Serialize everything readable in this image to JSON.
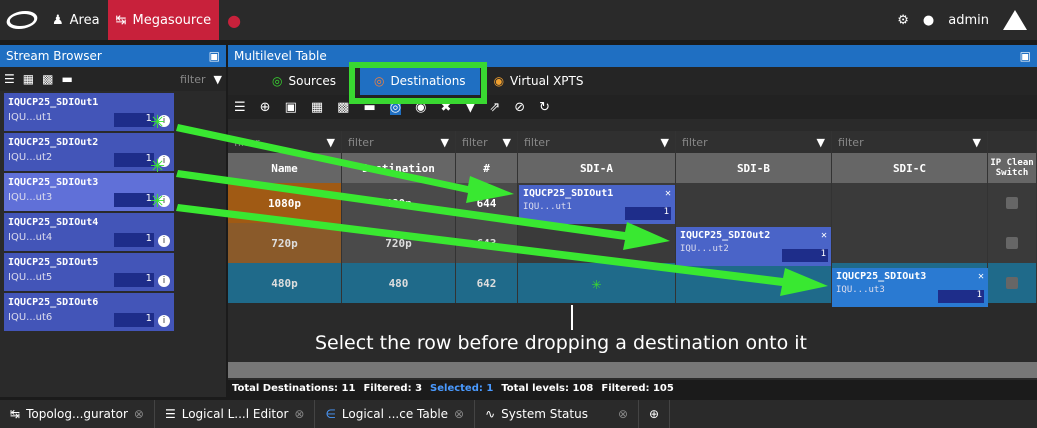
{
  "topbar": {
    "area": "Area",
    "megasource": "Megasource",
    "user": "admin"
  },
  "left": {
    "title": "Stream Browser",
    "filter": "filter",
    "items": [
      {
        "name": "IQUCP25_SDIOut1",
        "sub": "IQU...ut1",
        "count": "1"
      },
      {
        "name": "IQUCP25_SDIOut2",
        "sub": "IQU...ut2",
        "count": "1"
      },
      {
        "name": "IQUCP25_SDIOut3",
        "sub": "IQU...ut3",
        "count": "1"
      },
      {
        "name": "IQUCP25_SDIOut4",
        "sub": "IQU...ut4",
        "count": "1"
      },
      {
        "name": "IQUCP25_SDIOut5",
        "sub": "IQU...ut5",
        "count": "1"
      },
      {
        "name": "IQUCP25_SDIOut6",
        "sub": "IQU...ut6",
        "count": "1"
      }
    ]
  },
  "right": {
    "title": "Multilevel Table",
    "tabs": [
      "Sources",
      "Destinations",
      "Virtual XPTS"
    ],
    "filters": [
      "filter",
      "filter",
      "filter",
      "filter",
      "filter",
      "filter"
    ],
    "headers": [
      "Name",
      "Destination",
      "#",
      "SDI-A",
      "SDI-B",
      "SDI-C",
      "IP Clean Switch"
    ],
    "rows": [
      {
        "name": "1080p",
        "dest": "480p",
        "num": "644"
      },
      {
        "name": "720p",
        "dest": "720p",
        "num": "643"
      },
      {
        "name": "480p",
        "dest": "480",
        "num": "642"
      }
    ],
    "drops": [
      {
        "name": "IQUCP25_SDIOut1",
        "sub": "IQU...ut1",
        "count": "1"
      },
      {
        "name": "IQUCP25_SDIOut2",
        "sub": "IQU...ut2",
        "count": "1"
      },
      {
        "name": "IQUCP25_SDIOut3",
        "sub": "IQU...ut3",
        "count": "1"
      }
    ],
    "status": {
      "total": "Total Destinations: 11",
      "filtered": "Filtered: 3",
      "selected": "Selected: 1",
      "levels": "Total levels: 108",
      "lfiltered": "Filtered: 105"
    }
  },
  "caption": "Select the row before dropping a destination onto it",
  "bottom": [
    "Topolog...gurator",
    "Logical L...l Editor",
    "Logical ...ce Table",
    "System Status"
  ]
}
